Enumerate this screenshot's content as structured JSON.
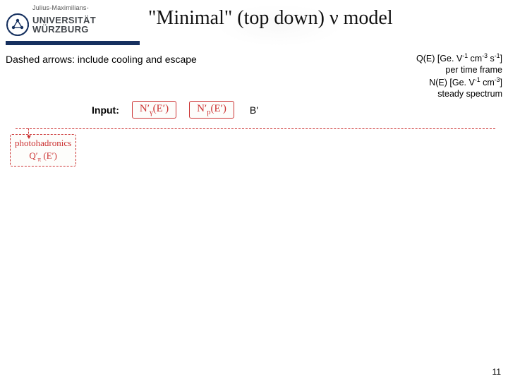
{
  "logo": {
    "topline": "Julius-Maximilians-",
    "line1": "UNIVERSITÄT",
    "line2": "WÜRZBURG"
  },
  "title": "\"Minimal\" (top down) ν model",
  "dashed_note": "Dashed arrows: include cooling and escape",
  "input_label": "Input:",
  "inputs": {
    "n_gamma": "N′_γ(E′)",
    "n_p": "N′_p(E′)",
    "b": "B'"
  },
  "q_info": {
    "l1_a": "Q(E) [Ge. V",
    "l1_b": " cm",
    "l1_c": " s",
    "l1_d": "]",
    "l2": "per time frame",
    "l3_a": "N(E) [Ge. V",
    "l3_b": " cm",
    "l3_c": "]",
    "l4": "steady spectrum"
  },
  "diagram": {
    "photohadronics": "photohadronics",
    "q_pi": "Q′_π (E′)"
  },
  "slide_number": "11"
}
